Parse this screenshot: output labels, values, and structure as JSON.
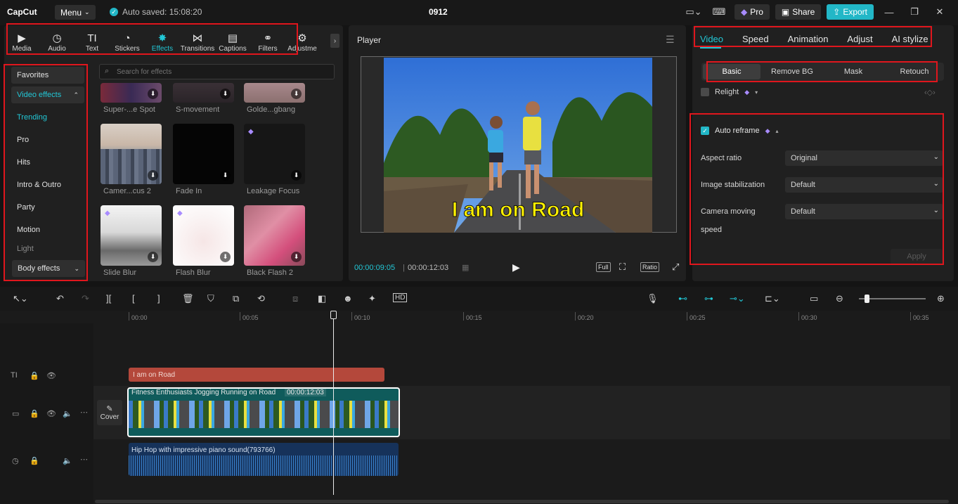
{
  "app": {
    "logo": "CapCut",
    "menu_label": "Menu",
    "autosave": "Auto saved: 15:08:20",
    "project_title": "0912",
    "pro_label": "Pro",
    "share_label": "Share",
    "export_label": "Export"
  },
  "tool_tabs": [
    {
      "label": "Media",
      "icon": "media-icon"
    },
    {
      "label": "Audio",
      "icon": "audio-icon"
    },
    {
      "label": "Text",
      "icon": "text-icon"
    },
    {
      "label": "Stickers",
      "icon": "stickers-icon"
    },
    {
      "label": "Effects",
      "icon": "effects-icon"
    },
    {
      "label": "Transitions",
      "icon": "transitions-icon"
    },
    {
      "label": "Captions",
      "icon": "captions-icon"
    },
    {
      "label": "Filters",
      "icon": "filters-icon"
    },
    {
      "label": "Adjustme",
      "icon": "adjustment-icon"
    }
  ],
  "categories": {
    "favorites": "Favorites",
    "video_effects": "Video effects",
    "items": [
      "Trending",
      "Pro",
      "Hits",
      "Intro & Outro",
      "Party",
      "Motion",
      "Light"
    ],
    "body_effects": "Body effects"
  },
  "search_placeholder": "Search for effects",
  "effects": [
    {
      "label": "Super-...e Spot"
    },
    {
      "label": "S-movement"
    },
    {
      "label": "Golde...gbang"
    },
    {
      "label": "Camer...cus 2"
    },
    {
      "label": "Fade In"
    },
    {
      "label": "Leakage Focus"
    },
    {
      "label": "Slide Blur"
    },
    {
      "label": "Flash Blur"
    },
    {
      "label": "Black Flash 2"
    }
  ],
  "player": {
    "title": "Player",
    "subtitle": "I am on Road",
    "time_current": "00:00:09:05",
    "time_total": "00:00:12:03",
    "full_label": "Full",
    "ratio_label": "Ratio"
  },
  "properties": {
    "tabs": [
      "Video",
      "Speed",
      "Animation",
      "Adjust",
      "AI stylize"
    ],
    "segments": [
      "Basic",
      "Remove BG",
      "Mask",
      "Retouch"
    ],
    "relight": "Relight",
    "auto_reframe": "Auto reframe",
    "aspect_ratio_label": "Aspect ratio",
    "aspect_ratio_value": "Original",
    "stabilization_label": "Image stabilization",
    "stabilization_value": "Default",
    "camera_speed_label_1": "Camera moving",
    "camera_speed_label_2": "speed",
    "camera_speed_value": "Default",
    "apply_label": "Apply"
  },
  "timeline": {
    "ticks": [
      "00:00",
      "00:05",
      "00:10",
      "00:15",
      "00:20",
      "00:25",
      "00:30",
      "00:35"
    ],
    "text_clip": "I am on Road",
    "video_clip_title": "Fitness Enthusiasts Jogging Running on Road",
    "video_clip_duration": "00:00:12:03",
    "cover_label": "Cover",
    "audio_clip": "Hip Hop with impressive piano sound(793766)"
  },
  "colors": {
    "accent": "#22c7d6",
    "highlight_box": "#e0161d",
    "text_clip": "#b4483b",
    "video_clip": "#0f5b5b",
    "audio_clip": "#16325a"
  }
}
